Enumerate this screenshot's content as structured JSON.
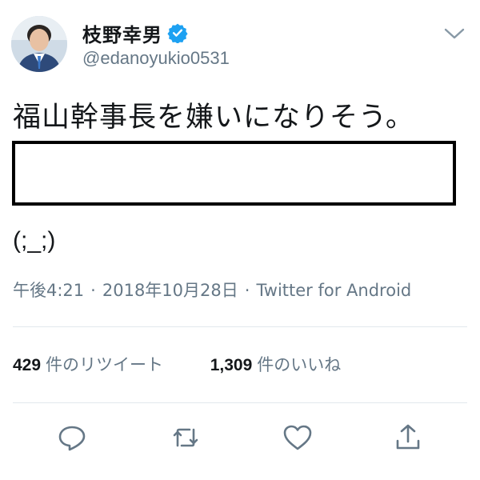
{
  "user": {
    "display_name": "枝野幸男",
    "handle": "@edanoyukio0531",
    "verified": true,
    "verified_color": "#1da1f2"
  },
  "tweet": {
    "text": "福山幹事長を嫌いになりそう。",
    "emoticon": "(;_;)"
  },
  "meta": {
    "time": "午後4:21",
    "separator": "·",
    "date": "2018年10月28日",
    "source": "Twitter for Android"
  },
  "stats": {
    "retweets_count": "429",
    "retweets_label": "件のリツイート",
    "likes_count": "1,309",
    "likes_label": "件のいいね"
  },
  "actions": {
    "icons": [
      "reply-icon",
      "retweet-icon",
      "like-icon",
      "share-icon"
    ]
  },
  "colors": {
    "text_primary": "#14171a",
    "text_secondary": "#657786",
    "divider": "#e1e8ed"
  }
}
